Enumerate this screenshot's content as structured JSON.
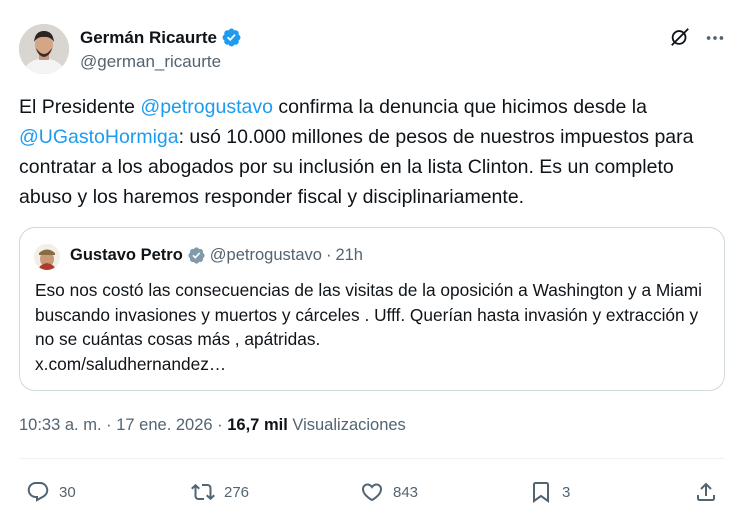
{
  "author": {
    "name": "Germán Ricaurte",
    "handle": "@german_ricaurte"
  },
  "tweet": {
    "text_parts": {
      "p1": "El Presidente ",
      "m1": "@petrogustavo",
      "p2": " confirma la denuncia que hicimos desde la ",
      "m2": "@UGastoHormiga",
      "p3": ": usó 10.000 millones de pesos de nuestros impuestos para contratar a los abogados por su inclusión en la lista Clinton. Es un completo abuso y los haremos responder fiscal y disciplinariamente."
    }
  },
  "quote": {
    "name": "Gustavo Petro",
    "handle": "@petrogustavo",
    "separator": "·",
    "time": "21h",
    "text": "Eso nos costó las consecuencias de las visitas de la oposición a Washington y a Miami buscando invasiones y muertos y cárceles . Ufff. Querían hasta invasión y extracción y no se cuántas cosas más , apátridas.",
    "link": "x.com/saludhernandez…"
  },
  "meta": {
    "time": "10:33 a. m.",
    "sep1": " · ",
    "date": "17 ene. 2026",
    "sep2": " · ",
    "views_count": "16,7 mil",
    "views_label": " Visualizaciones"
  },
  "actions": {
    "replies": "30",
    "retweets": "276",
    "likes": "843",
    "bookmarks": "3"
  },
  "colors": {
    "accent": "#1d9bf0",
    "secondary_text": "#536471",
    "border": "#cfd9de"
  },
  "icons": [
    "verified-badge-icon",
    "grok-icon",
    "more-icon",
    "reply-icon",
    "retweet-icon",
    "like-icon",
    "bookmark-icon",
    "share-icon"
  ]
}
